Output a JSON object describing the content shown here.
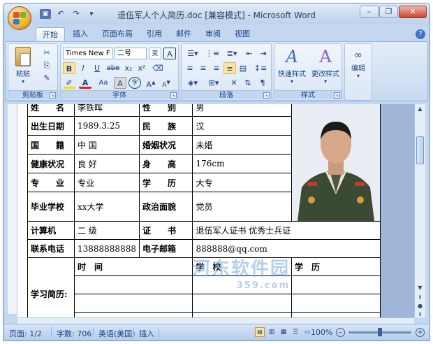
{
  "window": {
    "title": "退伍军人个人简历.doc [兼容模式] - Microsoft Word",
    "controls": [
      "minimize",
      "restore",
      "close"
    ]
  },
  "quick_access": [
    {
      "name": "save-icon"
    },
    {
      "name": "undo-icon"
    },
    {
      "name": "redo-icon"
    },
    {
      "name": "customize-qat-icon"
    }
  ],
  "tabs": [
    "开始",
    "插入",
    "页面布局",
    "引用",
    "邮件",
    "审阅",
    "视图"
  ],
  "active_tab": "开始",
  "ribbon": {
    "clipboard": {
      "paste_label": "粘贴",
      "group_label": "剪贴板"
    },
    "font": {
      "font_name": "Times New F",
      "font_size": "二号",
      "group_label": "字体",
      "change_case_label": "Aa",
      "char_border_label": "A",
      "bold": "B",
      "italic": "I",
      "underline": "U",
      "strike": "abe",
      "subscript": "x₂",
      "superscript": "x²",
      "font_color": "A"
    },
    "paragraph": {
      "group_label": "段落"
    },
    "styles": {
      "quick_styles_label": "快速样式",
      "change_styles_label": "更改样式",
      "group_label": "样式"
    },
    "editing": {
      "label": "编辑"
    }
  },
  "resume": {
    "row0": {
      "l1": "姓　　名",
      "v1": "李铁晖",
      "l2": "性　　别",
      "v2": "男"
    },
    "row1": {
      "l1": "出生日期",
      "v1": "1989.3.25",
      "l2": "民　　族",
      "v2": "汉"
    },
    "row2": {
      "l1": "国　　籍",
      "v1": "中 国",
      "l2": "婚姻状况",
      "v2": "未婚"
    },
    "row3": {
      "l1": "健康状况",
      "v1": "良 好",
      "l2": "身　　高",
      "v2": "176cm"
    },
    "row4": {
      "l1": "专　　业",
      "v1": "专业",
      "l2": "学　　历",
      "v2": "大专"
    },
    "row5": {
      "l1": "毕业学校",
      "v1": "xx大学",
      "l2": "政治面貌",
      "v2": "党员"
    },
    "row6": {
      "l1": "计算机",
      "v1": "二 级",
      "l2": "证　　书",
      "v2": "退伍军人证书 优秀士兵证"
    },
    "row7": {
      "l1": "联系电话",
      "v1": "13888888888",
      "l2": "电子邮箱",
      "v2": "888888@qq.com"
    },
    "edu": {
      "label": "学习简历:",
      "h_time": "时　间",
      "h_school": "学　校",
      "h_degree": "学　历"
    }
  },
  "watermark": {
    "text": "河东软件园",
    "sub": "359.com"
  },
  "statusbar": {
    "page": "页面: 1/2",
    "words": "字数: 706",
    "language": "英语(美国)",
    "mode": "插入",
    "zoom": "100%",
    "zoom_level": 100
  },
  "colors": {
    "accent": "#15428b",
    "ribbon_bg": "#dbe7f6",
    "title_bg": "#c9daf0",
    "close_red": "#c9442e"
  }
}
